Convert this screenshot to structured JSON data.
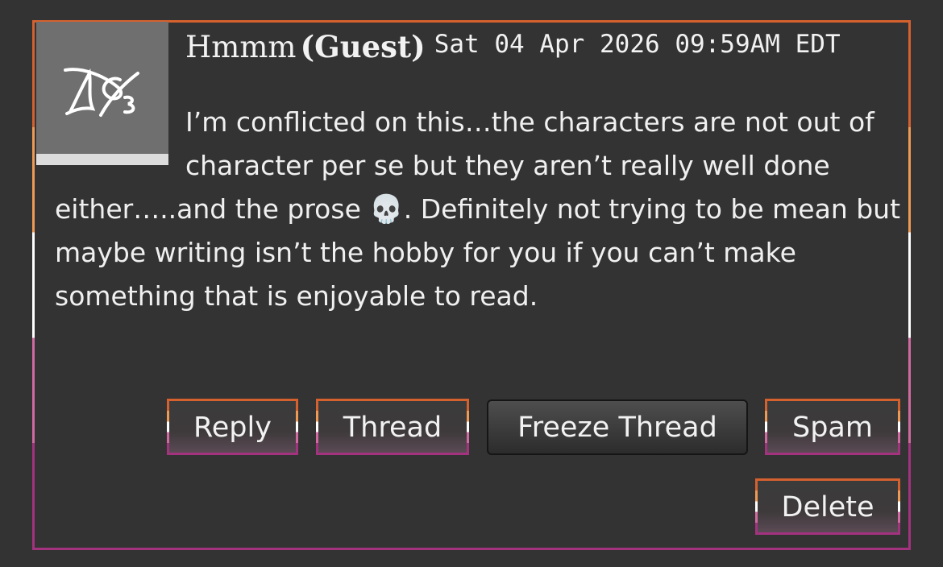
{
  "comment": {
    "author": "Hmmm",
    "guest_label": "(Guest)",
    "timestamp": "Sat 04 Apr 2026 09:59AM EDT",
    "body_part1": "I’m conflicted on this…the characters are not out of character per se but they aren’t really well done either…..and the prose ",
    "body_emoji": "💀",
    "body_part2": ". Definitely not trying to be mean but maybe writing isn’t the hobby for you if you can’t make something that is enjoyable to read.",
    "avatar_icon": "ao3-logo-icon"
  },
  "actions": {
    "reply": "Reply",
    "thread": "Thread",
    "freeze_thread": "Freeze Thread",
    "spam": "Spam",
    "delete": "Delete"
  },
  "colors": {
    "background": "#333333",
    "border_stripe_1": "#d5612f",
    "border_stripe_2": "#ef9a54",
    "border_stripe_3": "#ffffff",
    "border_stripe_4": "#d06aa0",
    "border_stripe_5": "#a3327f"
  }
}
